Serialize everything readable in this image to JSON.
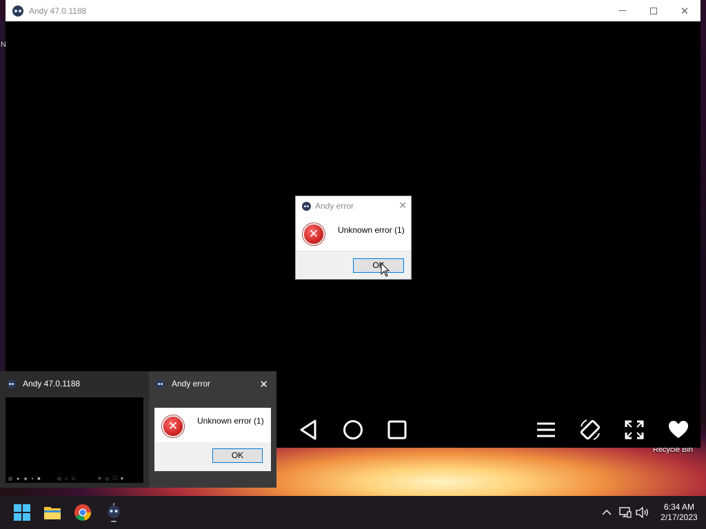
{
  "desktop": {
    "stray_text": "N",
    "recycle_bin_label": "Recycle Bin"
  },
  "andy_window": {
    "title": "Andy 47.0.1188",
    "controls": {
      "minimize": "─",
      "close": "✕"
    }
  },
  "error_dialog": {
    "title": "Andy error",
    "message": "Unknown error (1)",
    "ok_label": "OK",
    "close_glyph": "✕"
  },
  "task_preview": {
    "window1_title": "Andy 47.0.1188",
    "window2_title": "Andy error",
    "window2_message": "Unknown error (1)",
    "window2_ok_label": "OK",
    "close_glyph": "✕"
  },
  "android_nav": {
    "icons": [
      "back-icon",
      "home-icon",
      "recents-icon",
      "menu-icon",
      "rotate-icon",
      "fullscreen-icon",
      "heart-icon"
    ]
  },
  "taskbar": {
    "apps": [
      "windows-start-icon",
      "file-explorer-icon",
      "chrome-icon",
      "andy-icon"
    ],
    "tray": {
      "time": "6:34 AM",
      "date": "2/17/2023",
      "icons": [
        "chevron-up-icon",
        "network-icon",
        "volume-icon"
      ]
    }
  },
  "colors": {
    "title_gray": "#8a8a8a",
    "ok_border": "#0078d7",
    "error_red": "#c81e1e",
    "taskbar": "#1f1a20"
  }
}
